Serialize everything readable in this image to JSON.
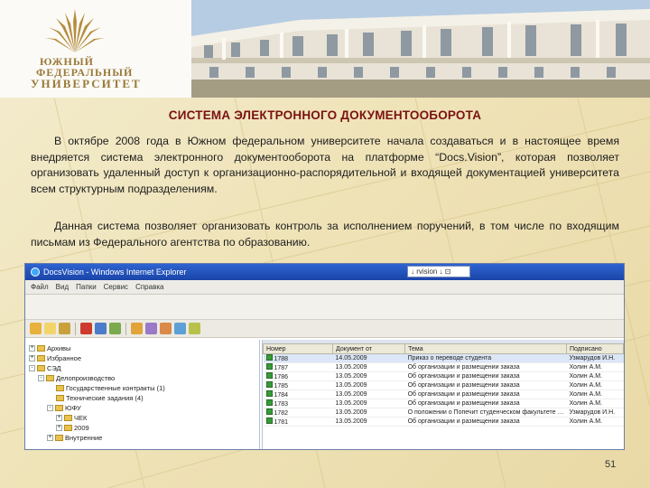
{
  "logo": {
    "line1": "ЮЖНЫЙ",
    "line2": "ФЕДЕРАЛЬНЫЙ",
    "line3": "УНИВЕРСИТЕТ"
  },
  "slide": {
    "title": "СИСТЕМА ЭЛЕКТРОННОГО ДОКУМЕНТООБОРОТА",
    "paragraph1": "В октябре  2008 года в Южном федеральном университете начала создаваться и в настоящее время внедряется система электронного документооборота на платформе “Docs.Vision”,  которая позволяет организовать удаленный доступ к организационно-распорядительной  и входящей документацией университета  всем структурным подразделениям.",
    "paragraph2": "Данная система позволяет организовать контроль за исполнением поручений, в том числе по входящим письмам из Федерального агентства по образованию.",
    "page_number": "51"
  },
  "window": {
    "title": "DocsVision - Windows Internet Explorer",
    "address": "↓ rvision ↓ ⊡",
    "menu": [
      "Файл",
      "Вид",
      "Папки",
      "Сервис",
      "Справка"
    ],
    "tree": [
      {
        "label": "Архивы",
        "level": 0,
        "toggle": "+"
      },
      {
        "label": "Избранное",
        "level": 0,
        "toggle": "+"
      },
      {
        "label": "СЭД",
        "level": 0,
        "toggle": "-"
      },
      {
        "label": "Делопроизводство",
        "level": 1,
        "toggle": "-"
      },
      {
        "label": "Государственные контракты (1)",
        "level": 2,
        "toggle": ""
      },
      {
        "label": "Технические задания (4)",
        "level": 2,
        "toggle": ""
      },
      {
        "label": "ЮФУ",
        "level": 1,
        "toggle": "-"
      },
      {
        "label": "ЧЕК",
        "level": 2,
        "toggle": "+"
      },
      {
        "label": "2009",
        "level": 2,
        "toggle": "+"
      },
      {
        "label": "Внутренние",
        "level": 1,
        "toggle": "+"
      }
    ],
    "grid": {
      "columns": [
        "Номер",
        "Документ от",
        "Тема",
        "Подписано"
      ],
      "rows": [
        {
          "num": "1788",
          "date": "14.05.2009",
          "topic": "Приказ о переводе студента",
          "signed": "Узмарудов И.Н."
        },
        {
          "num": "1787",
          "date": "13.05.2009",
          "topic": "Об организации и размещении заказа",
          "signed": "Холин А.М."
        },
        {
          "num": "1786",
          "date": "13.05.2009",
          "topic": "Об организации и размещении заказа",
          "signed": "Холин А.М."
        },
        {
          "num": "1785",
          "date": "13.05.2009",
          "topic": "Об организации и размещении заказа",
          "signed": "Холин А.М."
        },
        {
          "num": "1784",
          "date": "13.05.2009",
          "topic": "Об организации и размещении заказа",
          "signed": "Холин А.М."
        },
        {
          "num": "1783",
          "date": "13.05.2009",
          "topic": "Об организации и размещении заказа",
          "signed": "Холин А.М."
        },
        {
          "num": "1782",
          "date": "13.05.2009",
          "topic": "О положении о Попечит студенческом факультете …",
          "signed": "Узмарудов И.Н."
        },
        {
          "num": "1781",
          "date": "13.05.2009",
          "topic": "Об организации и размещении заказа",
          "signed": "Холин А.М."
        }
      ]
    }
  },
  "colors": {
    "title": "#7a1212",
    "window_titlebar": "#2e63d0",
    "background": "#efe3b8"
  }
}
